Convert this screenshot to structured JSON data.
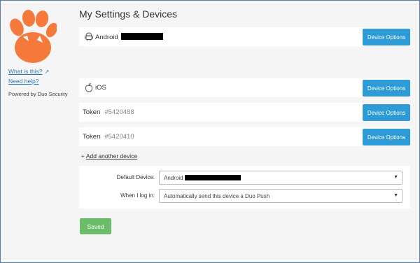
{
  "sidebar": {
    "logo_name": "paw-logo",
    "what_is_this": "What is this?",
    "need_help": "Need help?",
    "powered_by": "Powered by Duo Security"
  },
  "header": {
    "title": "My Settings & Devices"
  },
  "devices": [
    {
      "icon": "android-icon",
      "label": "Android",
      "number": "",
      "redacted": true,
      "button": "Device Options"
    },
    {
      "icon": "apple-icon",
      "label": "iOS",
      "number": "",
      "redacted": false,
      "button": "Device Options"
    },
    {
      "icon": "",
      "label": "Token",
      "number": "#5420488",
      "redacted": false,
      "button": "Device Options"
    },
    {
      "icon": "",
      "label": "Token",
      "number": "#5420410",
      "redacted": false,
      "button": "Device Options"
    }
  ],
  "add_device": {
    "prefix": "+",
    "label": "Add another device"
  },
  "settings": {
    "default_device_label": "Default Device:",
    "default_device_value": "Android",
    "login_label": "When I log in:",
    "login_value": "Automatically send this device a Duo Push"
  },
  "saved_button": "Saved",
  "colors": {
    "accent": "#2e9bd6",
    "success": "#6cbd69",
    "logo": "#f5793a",
    "link": "#2a7ab8"
  }
}
